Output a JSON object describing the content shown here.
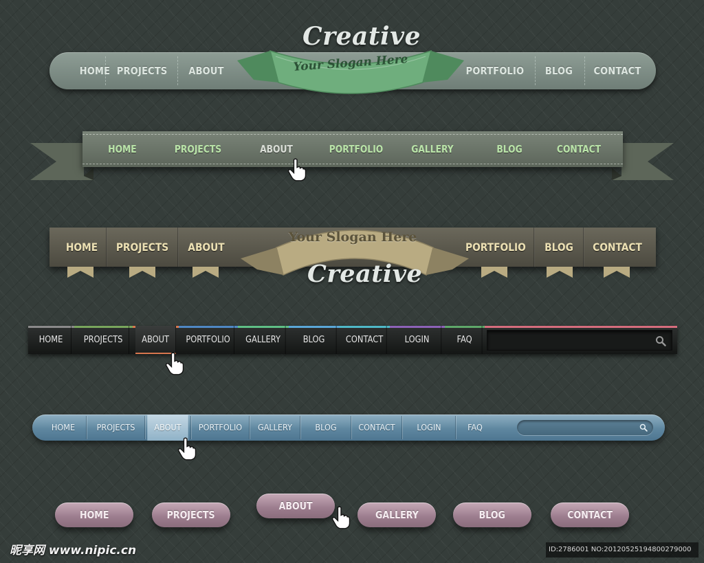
{
  "nav1": {
    "brand": "Creative",
    "slogan": "Your Slogan Here",
    "items_left": [
      "HOME",
      "PROJECTS",
      "ABOUT"
    ],
    "items_right": [
      "PORTFOLIO",
      "BLOG",
      "CONTACT"
    ],
    "ribbon_color": "#6fae7d"
  },
  "nav2": {
    "items": [
      "HOME",
      "PROJECTS",
      "ABOUT",
      "PORTFOLIO",
      "GALLERY",
      "BLOG",
      "CONTACT"
    ],
    "active": "ABOUT"
  },
  "nav3": {
    "slogan": "Your Slogan Here",
    "brand": "Creative",
    "items_left": [
      "HOME",
      "PROJECTS",
      "ABOUT"
    ],
    "items_right": [
      "PORTFOLIO",
      "BLOG",
      "CONTACT"
    ],
    "ribbon_color": "#b9ab82"
  },
  "nav4": {
    "items": [
      "HOME",
      "PROJECTS",
      "ABOUT",
      "PORTFOLIO",
      "GALLERY",
      "BLOG",
      "CONTACT",
      "LOGIN",
      "FAQ"
    ],
    "active": "ABOUT",
    "accent_colors": [
      "#8a8a8a",
      "#79a65c",
      "#d8774e",
      "#4f88c4",
      "#5fbf86",
      "#5aa7d8",
      "#4fb9c8",
      "#8d62b8",
      "#5fa86a"
    ],
    "search_icon": "search-icon"
  },
  "nav5": {
    "items": [
      "HOME",
      "PROJECTS",
      "ABOUT",
      "PORTFOLIO",
      "GALLERY",
      "BLOG",
      "CONTACT",
      "LOGIN",
      "FAQ"
    ],
    "active": "ABOUT",
    "search_icon": "search-icon"
  },
  "nav6": {
    "items": [
      "HOME",
      "PROJECTS",
      "ABOUT",
      "GALLERY",
      "BLOG",
      "CONTACT"
    ],
    "active": "ABOUT"
  },
  "footer": {
    "watermark": "昵享网 www.nipic.cn",
    "image_id": "ID:2786001 NO:20120525194800279000"
  }
}
